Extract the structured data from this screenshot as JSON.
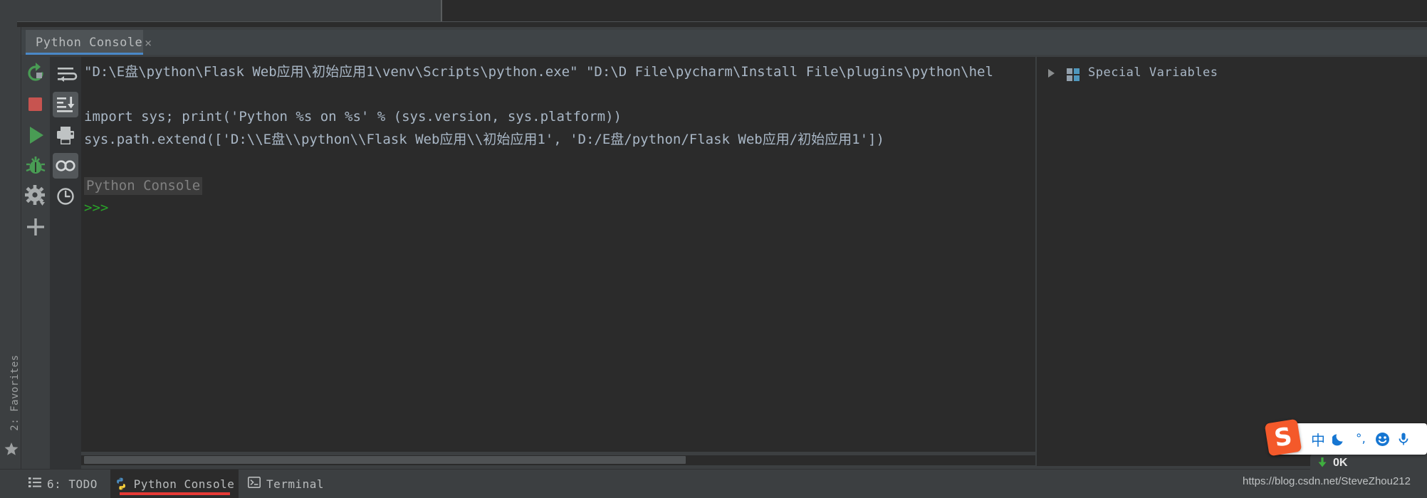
{
  "window": {
    "theme": "darcula"
  },
  "tool_window": {
    "tab": {
      "label": "Python Console",
      "close_glyph": "×"
    }
  },
  "sidebar": {
    "favorites_label": "2: Favorites",
    "star_icon": "star-icon"
  },
  "left_toolbar": {
    "items": [
      {
        "name": "rerun-icon",
        "tooltip": "Rerun"
      },
      {
        "name": "stop-icon",
        "tooltip": "Stop"
      },
      {
        "name": "run-icon",
        "tooltip": "Execute"
      },
      {
        "name": "debug-icon",
        "tooltip": "Attach Debugger"
      },
      {
        "name": "settings-icon",
        "tooltip": "Settings"
      },
      {
        "name": "plus-icon",
        "tooltip": "New Console"
      }
    ]
  },
  "second_toolbar": {
    "items": [
      {
        "name": "soft-wrap-icon",
        "tooltip": "Use Soft Wraps",
        "active": false
      },
      {
        "name": "scroll-to-end-icon",
        "tooltip": "Scroll to the end",
        "active": true
      },
      {
        "name": "print-icon",
        "tooltip": "Print",
        "active": false
      },
      {
        "name": "preview-icon",
        "tooltip": "Show Variables",
        "active": true
      },
      {
        "name": "history-icon",
        "tooltip": "Browse History",
        "active": false
      }
    ]
  },
  "console": {
    "lines": [
      "\"D:\\E盘\\python\\Flask Web应用\\初始应用1\\venv\\Scripts\\python.exe\" \"D:\\D File\\pycharm\\Install File\\plugins\\python\\hel",
      "import sys; print('Python %s on %s' % (sys.version, sys.platform))",
      "sys.path.extend(['D:\\\\E盘\\\\python\\\\Flask Web应用\\\\初始应用1', 'D:/E盘/python/Flask Web应用/初始应用1'])"
    ],
    "banner": "Python Console",
    "prompt": ">>>",
    "colors": {
      "background": "#2b2b2b",
      "text": "#a9b7c6",
      "prompt": "#29a329",
      "banner_text": "#808080"
    }
  },
  "variables_panel": {
    "expand_arrow": "▶",
    "icon": "special-variables-icon",
    "label": "Special Variables"
  },
  "bottom_bar": {
    "buttons": [
      {
        "label": "6: TODO",
        "icon": "todo-list-icon",
        "active": false
      },
      {
        "label": "Python Console",
        "icon": "python-logo-icon",
        "active": true
      },
      {
        "label": "Terminal",
        "icon": "terminal-icon",
        "active": false
      }
    ],
    "active_underline_color": "#e53935",
    "watermark": "https://blog.csdn.net/SteveZhou212"
  },
  "ime_bar": {
    "logo_text": "S",
    "logo_color": "#f4592a",
    "items": [
      {
        "name": "language-mode-icon",
        "glyph": "中"
      },
      {
        "name": "moon-icon",
        "glyph": "☾"
      },
      {
        "name": "punctuation-icon",
        "glyph": "°,"
      },
      {
        "name": "emoji-icon",
        "glyph": "☻"
      },
      {
        "name": "microphone-icon",
        "glyph": "\u0001"
      }
    ]
  },
  "download_popup": {
    "text": "0K",
    "arrow_icon": "download-arrow-icon"
  }
}
